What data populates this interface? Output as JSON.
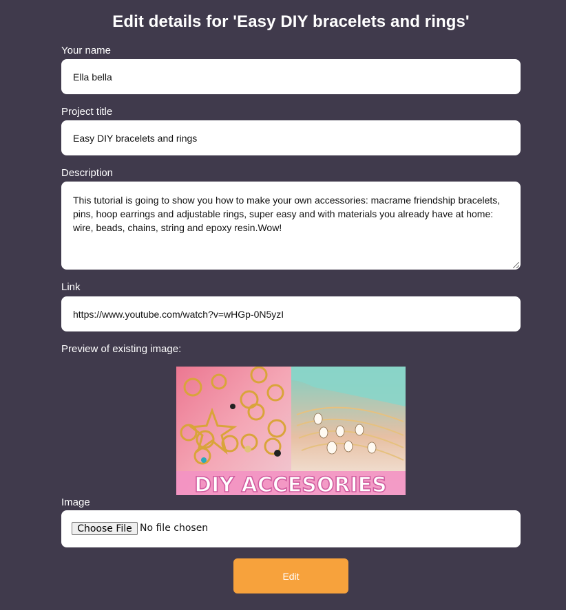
{
  "page": {
    "title": "Edit details for 'Easy DIY bracelets and rings'"
  },
  "form": {
    "name": {
      "label": "Your name",
      "value": "Ella bella"
    },
    "title": {
      "label": "Project title",
      "value": "Easy DIY bracelets and rings"
    },
    "description": {
      "label": "Description",
      "value": "This tutorial is going to show you how to make your own accessories: macrame friendship bracelets, pins, hoop earrings and adjustable rings, super easy and with materials you already have at home: wire, beads, chains, string and epoxy resin.Wow!"
    },
    "link": {
      "label": "Link",
      "value": "https://www.youtube.com/watch?v=wHGp-0N5yzI"
    },
    "preview": {
      "label": "Preview of existing image:",
      "banner_text": "DIY ACCESORIES"
    },
    "image": {
      "label": "Image",
      "button_label": "Choose File",
      "status": "No file chosen"
    },
    "submit_label": "Edit"
  },
  "colors": {
    "background": "#403a4c",
    "accent": "#f7a23c",
    "field": "#ffffff"
  }
}
